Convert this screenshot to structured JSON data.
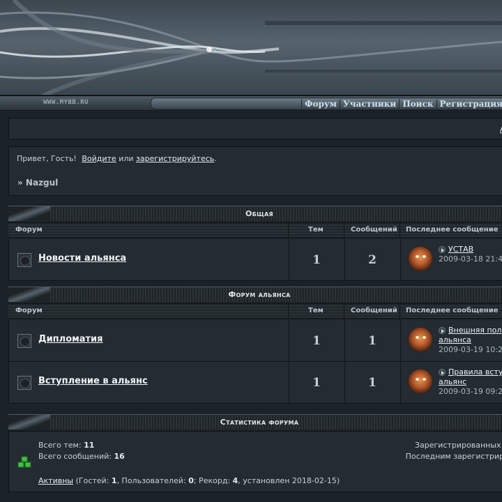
{
  "site": {
    "url": "WWW.MYBB.RU"
  },
  "nav": {
    "items": [
      "Форум",
      "Участники",
      "Поиск",
      "Регистрация"
    ]
  },
  "topbar": {
    "link": "А"
  },
  "welcome": {
    "greeting": "Привет, Гость!",
    "login": "Войдите",
    "or": "или",
    "register": "зарегистрируйтесь",
    "period": ".",
    "breadcrumb": "» Nazgul"
  },
  "columns": {
    "forum": "Форум",
    "topics": "Тем",
    "posts": "Сообщений",
    "last": "Последнее сообщение"
  },
  "categories": [
    {
      "title": "Общая",
      "forums": [
        {
          "name": "Новости альянса",
          "topics": "1",
          "posts": "2",
          "last_topic": "УСТАВ",
          "last_date": "2009-03-18 21:4"
        }
      ]
    },
    {
      "title": "Форум альянса",
      "forums": [
        {
          "name": "Дипломатия",
          "topics": "1",
          "posts": "1",
          "last_topic": "Внешняя пол альянса",
          "last_date": "2009-03-19 10:2"
        },
        {
          "name": "Вступление в альянс",
          "topics": "1",
          "posts": "1",
          "last_topic": "Правила всту альянс",
          "last_date": "2009-03-19 09:2"
        }
      ]
    }
  ],
  "stats": {
    "title": "Статистика форума",
    "topics_label": "Всего тем:",
    "topics_value": "11",
    "posts_label": "Всего сообщений:",
    "posts_value": "16",
    "registered_label": "Зарегистрированных пол",
    "last_registered_label": "Последним зарегистрирова",
    "online_link": "Активны",
    "guests_label": "(Гостей:",
    "guests_value": "1",
    "users_label": ", Пользователей:",
    "users_value": "0",
    "record_label": "; Рекорд:",
    "record_value": "4",
    "record_date": ", установлен 2018-02-15)"
  }
}
